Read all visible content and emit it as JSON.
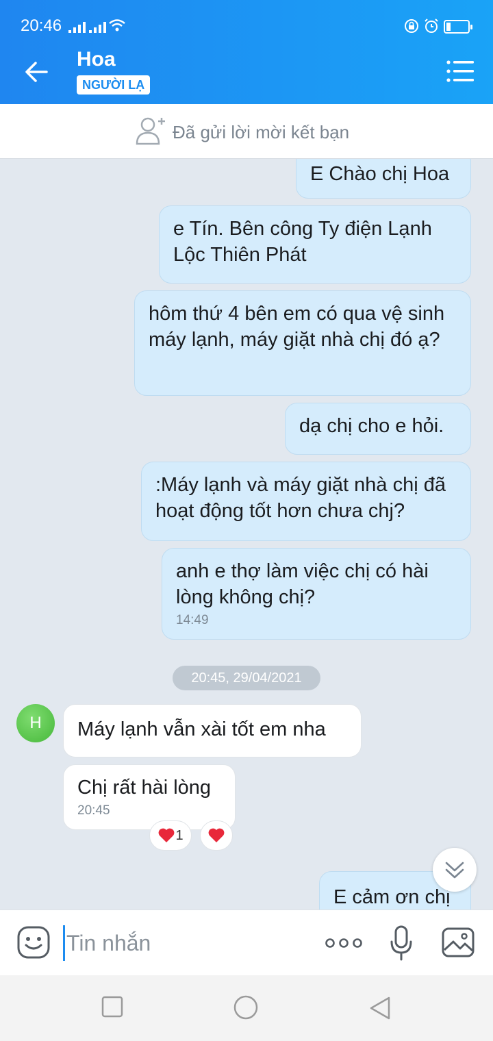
{
  "status_bar": {
    "time": "20:46"
  },
  "header": {
    "contact_name": "Hoa",
    "badge": "NGƯỜI LẠ"
  },
  "friend_request": {
    "text": "Đã gửi lời mời kết bạn"
  },
  "messages": [
    {
      "side": "out",
      "text": "E Chào chị Hoa"
    },
    {
      "side": "out",
      "text": "e Tín. Bên công Ty điện Lạnh Lộc Thiên Phát"
    },
    {
      "side": "out",
      "text": "hôm thứ 4 bên em có qua vệ sinh máy lạnh, máy giặt nhà chị đó ạ?"
    },
    {
      "side": "out",
      "text": "dạ chị cho e hỏi."
    },
    {
      "side": "out",
      "text": ":Máy lạnh và máy giặt nhà chị đã hoạt động tốt hơn chưa chj?"
    },
    {
      "side": "out",
      "text": "anh e thợ làm việc chị có hài lòng không chị?",
      "time": "14:49"
    },
    {
      "side": "in",
      "text": "Máy lạnh vẫn xài tốt em nha"
    },
    {
      "side": "in",
      "text": "Chị rất hài lòng",
      "time": "20:45"
    },
    {
      "side": "out",
      "text": "E cảm ơn chị"
    }
  ],
  "date_separator": "20:45, 29/04/2021",
  "avatar_initial": "H",
  "reactions": {
    "heart_count": "1",
    "heart_icon": "heart-icon"
  },
  "input": {
    "placeholder": "Tin nhắn"
  },
  "colors": {
    "header": "#1a95f3",
    "outgoing_bubble": "#d5ecfc",
    "incoming_bubble": "#ffffff",
    "chat_background": "#e2e8ef"
  }
}
